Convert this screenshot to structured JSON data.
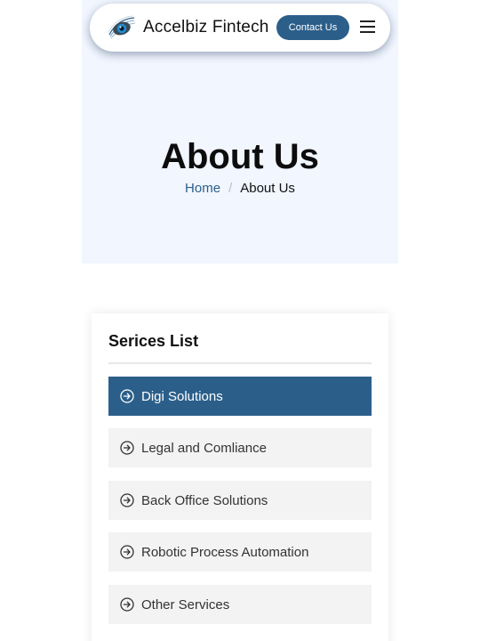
{
  "header": {
    "brand_name": "Accelbiz Fintech",
    "logo_icon": "eye-logo-icon",
    "contact_button_label": "Contact Us",
    "menu_icon": "hamburger-menu-icon"
  },
  "hero": {
    "title": "About Us",
    "breadcrumb": {
      "home_label": "Home",
      "separator": "/",
      "current_label": "About Us"
    }
  },
  "services": {
    "heading": "Serices List",
    "items": [
      {
        "label": "Digi Solutions",
        "active": true
      },
      {
        "label": "Legal and Comliance",
        "active": false
      },
      {
        "label": "Back Office Solutions",
        "active": false
      },
      {
        "label": "Robotic Process Automation",
        "active": false
      },
      {
        "label": "Other Services",
        "active": false
      }
    ],
    "item_icon": "circle-arrow-right-icon"
  },
  "colors": {
    "brand_blue": "#2b5f8a",
    "hero_background": "#f1f6ff",
    "item_background": "#f3f3f4"
  }
}
